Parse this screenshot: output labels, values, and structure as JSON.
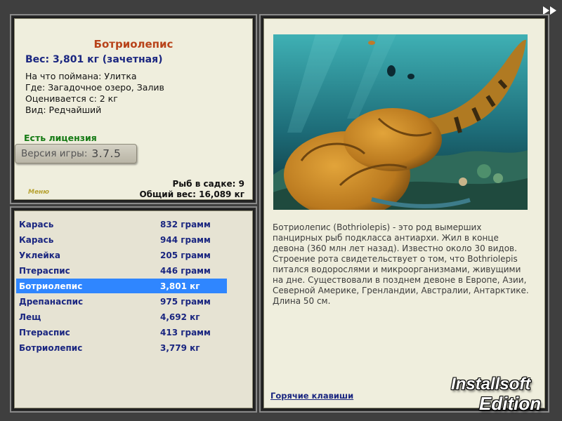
{
  "fish": {
    "title": "Ботриолепис",
    "weight_line": "Вес: 3,801 кг (зачетная)",
    "caught_on": "На что поймана: Улитка",
    "caught_where": "Где: Загадочное озеро, Залив",
    "valued_from": "Оценивается с: 2 кг",
    "rarity": "Вид: Редчайший"
  },
  "license": "Есть лицензия",
  "version": {
    "label": "Версия игры:",
    "value": "3.7.5"
  },
  "menu_logo": "Меню",
  "keepnet": {
    "count": "Рыб в садке: 9",
    "total_weight": "Общий вес: 16,089 кг"
  },
  "catch_list": [
    {
      "name": "Карась",
      "weight": "832 грамм"
    },
    {
      "name": "Карась",
      "weight": "944 грамм"
    },
    {
      "name": "Уклейка",
      "weight": "205 грамм"
    },
    {
      "name": "Птераспис",
      "weight": "446 грамм"
    },
    {
      "name": "Ботриолепис",
      "weight": "3,801 кг"
    },
    {
      "name": "Дрепанаспис",
      "weight": "975 грамм"
    },
    {
      "name": "Лещ",
      "weight": "4,692 кг"
    },
    {
      "name": "Птераспис",
      "weight": "413 грамм"
    },
    {
      "name": "Ботриолепис",
      "weight": "3,779 кг"
    }
  ],
  "selected_index": 4,
  "description": "Ботриолепис (Bothriolepis) - это род вымерших панцирных рыб подкласса антиархи. Жил в конце девона (360 млн лет назад). Известно около 30 видов. Строение рота свидетельствует о том, что Bothriolepis питался водорослями и микроорганизмами, живущими на дне. Существовали в позднем девоне в Европе, Азии, Северной Америке, Гренландии, Австралии, Антарктике. Длина 50 см.",
  "hotkeys_link": "Горячие клавиши",
  "watermark": {
    "line1": "Installsoft",
    "line2": "Edition"
  },
  "icons": {
    "skip": "fast-forward-icon"
  },
  "colors": {
    "title": "#b8431a",
    "accent_blue": "#1a2680",
    "license_green": "#157a14",
    "selection": "#2f86ff",
    "panel": "#efeedd"
  }
}
